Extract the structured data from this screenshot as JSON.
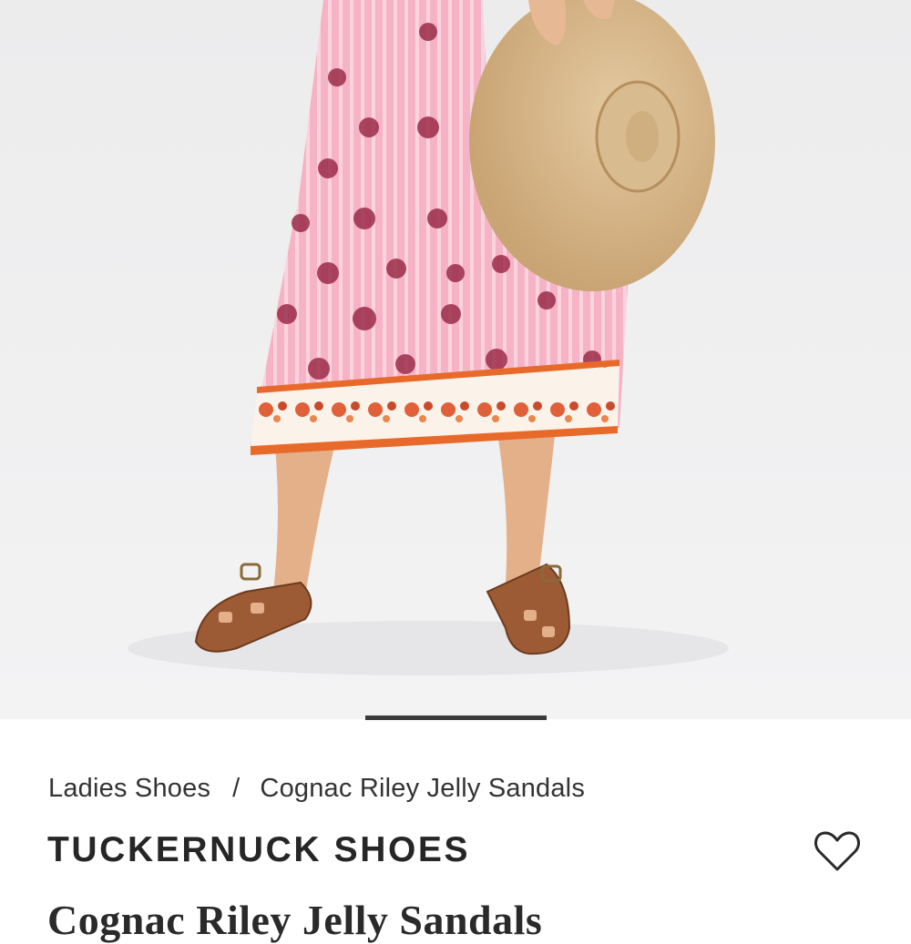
{
  "breadcrumb": {
    "category": "Ladies Shoes",
    "separator": "/",
    "current": "Cognac Riley Jelly Sandals"
  },
  "product": {
    "brand": "TUCKERNUCK SHOES",
    "title": "Cognac Riley Jelly Sandals"
  },
  "gallery": {
    "image_icon": "product-photo",
    "active_slide_indicator": "bar"
  },
  "wishlist": {
    "icon": "heart-outline-icon"
  },
  "colors": {
    "background": "#ffffff",
    "text": "#2a2a2a",
    "indicator": "#3a3a3a",
    "dress_pink": "#f3a9c0",
    "sandal_cognac": "#9a5a36",
    "hat_straw": "#d9b98c"
  }
}
